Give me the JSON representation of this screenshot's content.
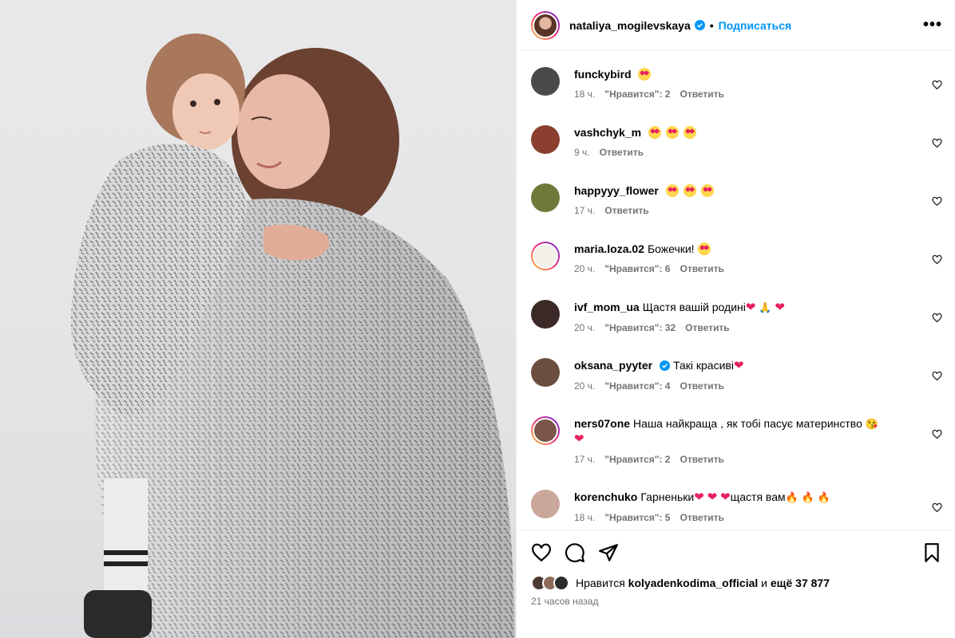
{
  "post": {
    "username": "nataliya_mogilevskaya",
    "follow_label": "Подписаться",
    "more_label": "•••",
    "dot": "•"
  },
  "comments": [
    {
      "user": "funckybird",
      "text": "",
      "emoji": [
        "heart-eyes"
      ],
      "time": "18 ч.",
      "likes": "\"Нравится\": 2",
      "reply": "Ответить",
      "avatar_color": "#4a4a4a"
    },
    {
      "user": "vashchyk_m",
      "text": "",
      "emoji": [
        "heart-eyes",
        "heart-eyes",
        "heart-eyes"
      ],
      "time": "9 ч.",
      "likes": "",
      "reply": "Ответить",
      "avatar_color": "#8a3f2f"
    },
    {
      "user": "happyyy_flower",
      "text": "",
      "emoji": [
        "heart-eyes",
        "heart-eyes",
        "heart-eyes"
      ],
      "time": "17 ч.",
      "likes": "",
      "reply": "Ответить",
      "avatar_color": "#6f7a3a"
    },
    {
      "user": "maria.loza.02",
      "text": "Божечки!",
      "emoji": [
        "heart-eyes"
      ],
      "time": "20 ч.",
      "likes": "\"Нравится\": 6",
      "reply": "Ответить",
      "avatar_color": "#f3efe9"
    },
    {
      "user": "ivf_mom_ua",
      "text": "Щастя вашій родині",
      "emoji": [],
      "time": "20 ч.",
      "likes": "\"Нравится\": 32",
      "reply": "Ответить",
      "avatar_color": "#3b2a28"
    },
    {
      "user": "oksana_pyyter",
      "text": "Такі красиві",
      "emoji": [],
      "time": "20 ч.",
      "likes": "\"Нравится\": 4",
      "reply": "Ответить",
      "avatar_color": "#6b4e3f"
    },
    {
      "user": "ners07one",
      "text": "Наша найкраща , як тобі пасує материнство",
      "emoji": [],
      "time": "17 ч.",
      "likes": "\"Нравится\": 2",
      "reply": "Ответить",
      "avatar_color": "#7a5548"
    },
    {
      "user": "korenchuko",
      "text": "Гарненьки",
      "text2": "щастя вам",
      "emoji": [],
      "time": "18 ч.",
      "likes": "\"Нравится\": 5",
      "reply": "Ответить",
      "avatar_color": "#c9a79a"
    }
  ],
  "footer": {
    "likes_prefix": "Нравится",
    "likes_user": "kolyadenkodima_official",
    "likes_and": "и",
    "likes_more": "ещё 37 877",
    "time": "21 часов назад"
  },
  "colors": {
    "accent": "#0095f6",
    "meta": "#737373",
    "heart": "#e8215f"
  }
}
